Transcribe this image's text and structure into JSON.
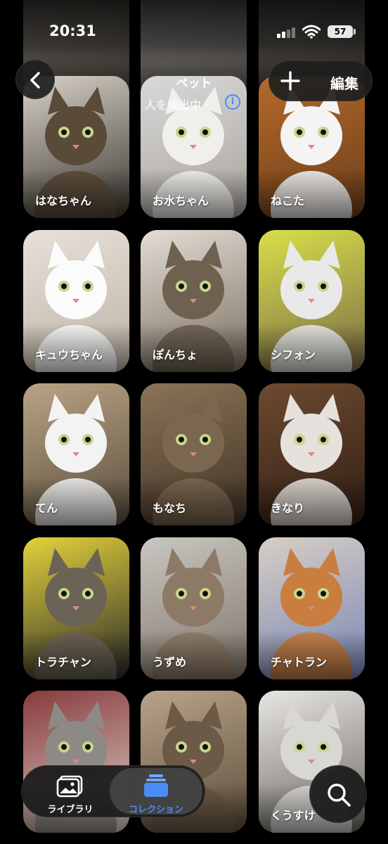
{
  "status_bar": {
    "time": "20:31",
    "battery": "57"
  },
  "nav": {
    "title": "ペット",
    "subtitle": "人を検出中 ·",
    "edit_label": "編集"
  },
  "pets": [
    {
      "name": "",
      "colors": [
        "#6f6a62",
        "#3a3631"
      ]
    },
    {
      "name": "",
      "colors": [
        "#7d7a76",
        "#4b4845"
      ]
    },
    {
      "name": "",
      "colors": [
        "#5a5650",
        "#2e2b28"
      ]
    },
    {
      "name": "はなちゃん",
      "colors": [
        "#d8d2c8",
        "#3b3630"
      ],
      "fur": "#5a4a38"
    },
    {
      "name": "お水ちゃん",
      "colors": [
        "#d9d9d9",
        "#a9a39d"
      ],
      "fur": "#f1efec"
    },
    {
      "name": "ねこた",
      "colors": [
        "#b56a2a",
        "#6b3d1a"
      ],
      "fur": "#f4f4f4"
    },
    {
      "name": "キュウちゃん",
      "colors": [
        "#e8e1d8",
        "#bdb3a6"
      ],
      "fur": "#fbfbfb"
    },
    {
      "name": "ぽんちょ",
      "colors": [
        "#e3ddd4",
        "#7a6e61"
      ],
      "fur": "#6e6150"
    },
    {
      "name": "シフォン",
      "colors": [
        "#d8e048",
        "#7b6a4a"
      ],
      "fur": "#e9e9ea"
    },
    {
      "name": "てん",
      "colors": [
        "#b9a484",
        "#5b4d3d"
      ],
      "fur": "#f3f3f3"
    },
    {
      "name": "もなち",
      "colors": [
        "#8c7558",
        "#3f3124"
      ],
      "fur": "#7b6650"
    },
    {
      "name": "きなり",
      "colors": [
        "#6e4a30",
        "#2f1e14"
      ],
      "fur": "#e6e1dc"
    },
    {
      "name": "トラチャン",
      "colors": [
        "#e3d23a",
        "#2b2b2b"
      ],
      "fur": "#6c6357"
    },
    {
      "name": "うずめ",
      "colors": [
        "#c9c6c1",
        "#7f756a"
      ],
      "fur": "#8d7a66"
    },
    {
      "name": "チャトラン",
      "colors": [
        "#d7cfc4",
        "#7886b5"
      ],
      "fur": "#c97d3f"
    },
    {
      "name": "",
      "colors": [
        "#8a3a3d",
        "#d8d0c8"
      ],
      "fur": "#8d8a86"
    },
    {
      "name": "",
      "colors": [
        "#b8a48a",
        "#5e4c3a"
      ],
      "fur": "#6d5a46"
    },
    {
      "name": "くうすけ",
      "colors": [
        "#e8e6e3",
        "#6a665f"
      ],
      "fur": "#d9d7d4"
    }
  ],
  "tabs": [
    {
      "label": "ライブラリ"
    },
    {
      "label": "コレクション"
    }
  ],
  "accent": "#4a8cf5"
}
